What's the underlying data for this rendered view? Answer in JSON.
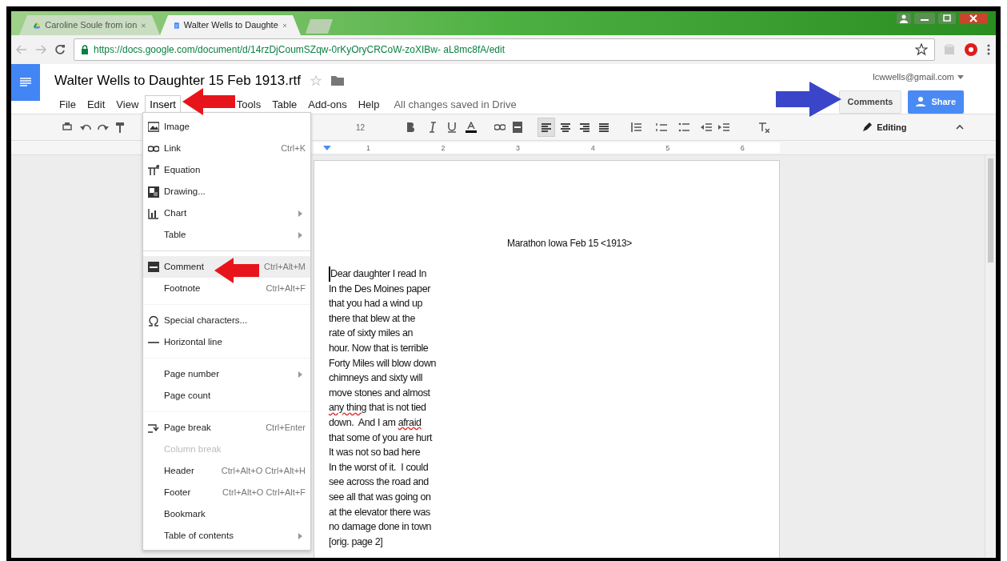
{
  "browser": {
    "tabs": [
      {
        "title": "Caroline Soule from ion",
        "selected": false
      },
      {
        "title": "Walter Wells to Daughte",
        "selected": true
      }
    ],
    "url": "https://docs.google.com/document/d/14rzDjCoumSZqw-0rKyOryCRCoW-zoXIBw- aL8mc8fA/edit"
  },
  "docs": {
    "title": "Walter Wells to Daughter 15 Feb 1913.rtf",
    "menu": [
      {
        "label": "File",
        "selected": false
      },
      {
        "label": "Edit",
        "selected": false
      },
      {
        "label": "View",
        "selected": false
      },
      {
        "label": "Insert",
        "selected": true
      },
      {
        "label": "Tools",
        "selected": false
      },
      {
        "label": "Table",
        "selected": false
      },
      {
        "label": "Add-ons",
        "selected": false
      },
      {
        "label": "Help",
        "selected": false
      }
    ],
    "save_status": "All changes saved in Drive",
    "account": "lcwwells@gmail.com",
    "comments_button": "Comments",
    "share_button": "Share"
  },
  "toolbar": {
    "font_size": "12",
    "align_buttons": [
      {
        "selected": true
      },
      {
        "selected": false
      },
      {
        "selected": false
      },
      {
        "selected": false
      }
    ],
    "mode": "Editing"
  },
  "ruler": [
    "1",
    "2",
    "3",
    "4",
    "5",
    "6"
  ],
  "insert_menu": [
    [
      {
        "label": "Image",
        "submenu": false,
        "selected": false,
        "disabled": false
      },
      {
        "label": "Link",
        "shortcut": "Ctrl+K",
        "submenu": false,
        "selected": false,
        "disabled": false
      },
      {
        "label": "Equation",
        "submenu": false,
        "selected": false,
        "disabled": false
      },
      {
        "label": "Drawing...",
        "submenu": false,
        "selected": false,
        "disabled": false
      },
      {
        "label": "Chart",
        "submenu": true,
        "selected": false,
        "disabled": false
      },
      {
        "label": "Table",
        "submenu": true,
        "selected": false,
        "disabled": false
      }
    ],
    [
      {
        "label": "Comment",
        "shortcut": "Ctrl+Alt+M",
        "submenu": false,
        "selected": true,
        "disabled": false
      },
      {
        "label": "Footnote",
        "shortcut": "Ctrl+Alt+F",
        "submenu": false,
        "selected": false,
        "disabled": false
      }
    ],
    [
      {
        "label": "Special characters...",
        "submenu": false,
        "selected": false,
        "disabled": false
      },
      {
        "label": "Horizontal line",
        "submenu": false,
        "selected": false,
        "disabled": false
      }
    ],
    [
      {
        "label": "Page number",
        "submenu": true,
        "selected": false,
        "disabled": false
      },
      {
        "label": "Page count",
        "submenu": false,
        "selected": false,
        "disabled": false
      }
    ],
    [
      {
        "label": "Page break",
        "shortcut": "Ctrl+Enter",
        "submenu": false,
        "selected": false,
        "disabled": false
      },
      {
        "label": "Column break",
        "submenu": false,
        "selected": false,
        "disabled": true
      },
      {
        "label": "Header",
        "shortcut": "Ctrl+Alt+O Ctrl+Alt+H",
        "submenu": false,
        "selected": false,
        "disabled": false
      },
      {
        "label": "Footer",
        "shortcut": "Ctrl+Alt+O Ctrl+Alt+F",
        "submenu": false,
        "selected": false,
        "disabled": false
      },
      {
        "label": "Bookmark",
        "submenu": false,
        "selected": false,
        "disabled": false
      },
      {
        "label": "Table of contents",
        "submenu": true,
        "selected": false,
        "disabled": false
      }
    ]
  ],
  "page": {
    "heading": "Marathon Iowa Feb 15 <1913>",
    "lines": [
      [
        {
          "text": "Dear daughter I read In",
          "misspelled": false
        }
      ],
      [
        {
          "text": "In the Des Moines paper",
          "misspelled": false
        }
      ],
      [
        {
          "text": "that you had a wind up",
          "misspelled": false
        }
      ],
      [
        {
          "text": "there that blew at the",
          "misspelled": false
        }
      ],
      [
        {
          "text": "rate of sixty miles an",
          "misspelled": false
        }
      ],
      [
        {
          "text": "hour. Now that is terrible",
          "misspelled": false
        }
      ],
      [
        {
          "text": "Forty Miles will blow down",
          "misspelled": false
        }
      ],
      [
        {
          "text": "chimneys and sixty will",
          "misspelled": false
        }
      ],
      [
        {
          "text": "move stones and almost",
          "misspelled": false
        }
      ],
      [
        {
          "text": "any thing",
          "misspelled": true
        },
        {
          "text": " that is not tied",
          "misspelled": false
        }
      ],
      [
        {
          "text": "down.  And I am ",
          "misspelled": false
        },
        {
          "text": "afraid",
          "misspelled": true
        }
      ],
      [
        {
          "text": "that some of you are hurt",
          "misspelled": false
        }
      ],
      [
        {
          "text": "It was not so bad here",
          "misspelled": false
        }
      ],
      [
        {
          "text": "In the worst of it.  I could",
          "misspelled": false
        }
      ],
      [
        {
          "text": "see across the road and",
          "misspelled": false
        }
      ],
      [
        {
          "text": "see all that was going on",
          "misspelled": false
        }
      ],
      [
        {
          "text": "at the elevator there was",
          "misspelled": false
        }
      ],
      [
        {
          "text": "no damage done in town",
          "misspelled": false
        }
      ],
      [
        {
          "text": "[orig. page 2]",
          "misspelled": false
        }
      ]
    ]
  }
}
